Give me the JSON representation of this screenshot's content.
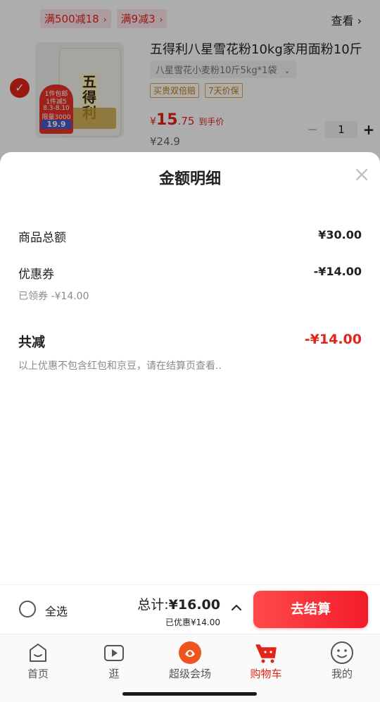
{
  "cart_item": {
    "promos": [
      {
        "label": "满500减18"
      },
      {
        "label": "满9减3"
      }
    ],
    "view_link": "查看 ›",
    "title": "五得利八星雪花粉10kg家用面粉10斤",
    "sku": "八星雪花小麦粉10斤5kg*1袋",
    "image_texts": {
      "brand": "五得利",
      "badge_top": "1件包邮",
      "badge_mid": "1件减5",
      "badge_date": "8.3-8.10",
      "badge_limit": "限量3000",
      "badge_price": "19.9"
    },
    "services": [
      "买贵双倍赔",
      "7天价保"
    ],
    "price_symbol": "¥",
    "price_int": "15",
    "price_dec": ".75",
    "price_note": "到手价",
    "original_price": "¥24.9",
    "quantity": "1",
    "minus": "−",
    "plus": "+"
  },
  "sheet": {
    "title": "金额明细",
    "goods_total_label": "商品总额",
    "goods_total_value": "¥30.00",
    "coupon_label": "优惠券",
    "coupon_value": "-¥14.00",
    "coupon_detail": "已领券 -¥14.00",
    "total_reduce_label": "共减",
    "total_reduce_value": "-¥14.00",
    "note": "以上优惠不包含红包和京豆，请在结算页查看.."
  },
  "checkout": {
    "select_all": "全选",
    "total_prefix": "总计:",
    "total_amount": "¥16.00",
    "saved": "已优惠¥14.00",
    "button": "去结算"
  },
  "tabs": [
    {
      "label": "首页",
      "icon": "home-icon"
    },
    {
      "label": "逛",
      "icon": "video-icon"
    },
    {
      "label": "超级会场",
      "icon": "super-venue-icon"
    },
    {
      "label": "购物车",
      "icon": "cart-icon"
    },
    {
      "label": "我的",
      "icon": "profile-icon"
    }
  ],
  "colors": {
    "accent": "#e1251b",
    "checkout_button": "#f21c2a"
  }
}
